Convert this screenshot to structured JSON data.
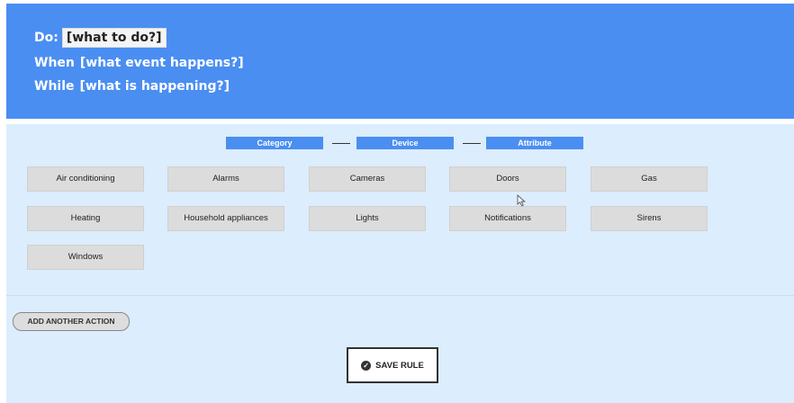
{
  "rule": {
    "do_label": "Do:",
    "do_value": "[what to do?]",
    "when_label": "When",
    "when_value": "[what event happens?]",
    "while_label": "While",
    "while_value": "[what is happening?]"
  },
  "steps": [
    "Category",
    "Device",
    "Attribute"
  ],
  "categories": [
    "Air conditioning",
    "Alarms",
    "Cameras",
    "Doors",
    "Gas",
    "Heating",
    "Household appliances",
    "Lights",
    "Notifications",
    "Sirens",
    "Windows"
  ],
  "actions": {
    "add_action_label": "ADD ANOTHER ACTION",
    "save_rule_label": "SAVE RULE"
  },
  "icons": {
    "save": "check-circle-icon",
    "pointer": "mouse-pointer-icon"
  },
  "colors": {
    "header_bg": "#4a8ef2",
    "body_bg": "#dcedfe",
    "tile_bg": "#dcdcdc"
  }
}
